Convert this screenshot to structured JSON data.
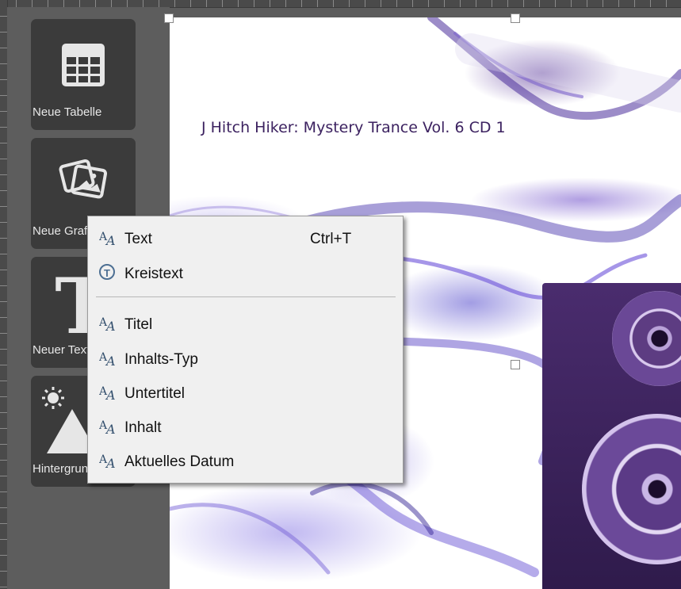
{
  "sidebar": {
    "buttons": [
      {
        "label": "Neue Tabelle",
        "icon": "table-icon"
      },
      {
        "label": "Neue Grafik",
        "icon": "image-icon"
      },
      {
        "label": "Neuer Text",
        "icon": "text-icon"
      },
      {
        "label": "Hintergrund",
        "icon": "background-icon"
      }
    ]
  },
  "canvas": {
    "title": "J Hitch Hiker: Mystery Trance Vol. 6 CD 1"
  },
  "context_menu": {
    "items": [
      {
        "label": "Text",
        "shortcut": "Ctrl+T",
        "icon": "text-style-icon"
      },
      {
        "label": "Kreistext",
        "icon": "circle-text-icon"
      },
      {
        "label": "Titel",
        "icon": "text-style-icon"
      },
      {
        "label": "Inhalts-Typ",
        "icon": "text-style-icon"
      },
      {
        "label": "Untertitel",
        "icon": "text-style-icon"
      },
      {
        "label": "Inhalt",
        "icon": "text-style-icon"
      },
      {
        "label": "Aktuelles Datum",
        "icon": "text-style-icon"
      }
    ]
  },
  "colors": {
    "sidebar_bg": "#5d5d5d",
    "button_bg": "#3b3b3b",
    "menu_bg": "#f0f0f0",
    "title_color": "#3c2260"
  }
}
